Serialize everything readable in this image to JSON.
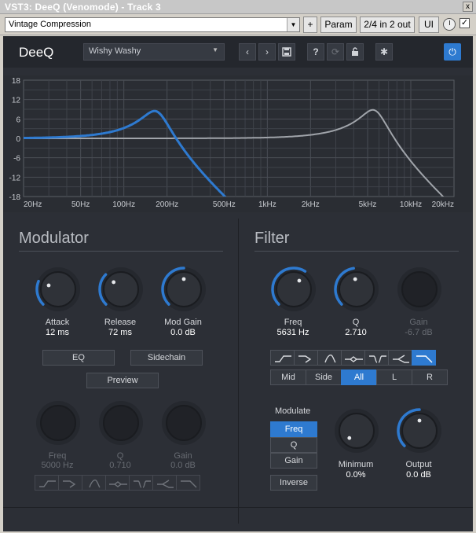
{
  "window": {
    "title": "VST3: DeeQ (Venomode) - Track 3",
    "close": "x"
  },
  "host": {
    "preset": "Vintage Compression",
    "plus": "+",
    "param": "Param",
    "io": "2/4 in 2 out",
    "ui": "UI",
    "checkbox": "✓"
  },
  "plugin": {
    "logo": "DeeQ",
    "preset": "Wishy Washy",
    "icons": [
      "prev-icon",
      "next-icon",
      "save-icon",
      "help-icon",
      "refresh-icon",
      "lock-icon",
      "gear-icon",
      "power-icon"
    ]
  },
  "graph": {
    "y_ticks": [
      "18",
      "12",
      "6",
      "0",
      "-6",
      "-12",
      "-18"
    ],
    "x_ticks": [
      "20Hz",
      "50Hz",
      "100Hz",
      "200Hz",
      "500Hz",
      "1kHz",
      "2kHz",
      "5kHz",
      "10kHz",
      "20kHz"
    ],
    "colors": {
      "eq_curve": "#2e7ad0",
      "filter_curve": "#a0a4aa",
      "flat": "#b8bcc2",
      "grid": "#4a4e56"
    }
  },
  "modulator": {
    "title": "Modulator",
    "knobs": [
      {
        "label": "Attack",
        "value": "12 ms"
      },
      {
        "label": "Release",
        "value": "72 ms"
      },
      {
        "label": "Mod Gain",
        "value": "0.0 dB"
      }
    ],
    "eq_button": "EQ",
    "sidechain_button": "Sidechain",
    "preview_button": "Preview",
    "eq_knobs": [
      {
        "label": "Freq",
        "value": "5000 Hz"
      },
      {
        "label": "Q",
        "value": "0.710"
      },
      {
        "label": "Gain",
        "value": "0.0 dB"
      }
    ]
  },
  "filter": {
    "title": "Filter",
    "knobs": [
      {
        "label": "Freq",
        "value": "5631 Hz"
      },
      {
        "label": "Q",
        "value": "2.710"
      },
      {
        "label": "Gain",
        "value": "-6.7 dB"
      }
    ],
    "channels": [
      "Mid",
      "Side",
      "All",
      "L",
      "R"
    ],
    "active_channel": "All",
    "modulate_label": "Modulate",
    "modulate_options": [
      "Freq",
      "Q",
      "Gain"
    ],
    "active_modulate": "Freq",
    "inverse_button": "Inverse",
    "minimum": {
      "label": "Minimum",
      "value": "0.0%"
    },
    "output": {
      "label": "Output",
      "value": "0.0 dB"
    }
  }
}
